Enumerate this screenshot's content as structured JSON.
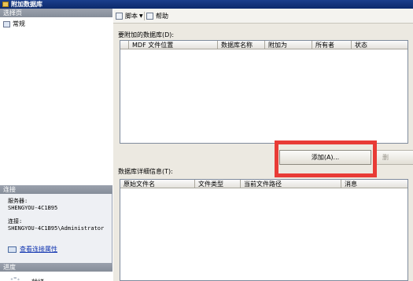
{
  "window": {
    "title": "附加数据库"
  },
  "left_panel": {
    "select_page_header": "选择页",
    "pages": [
      {
        "label": "常规"
      }
    ],
    "connection_header": "连接",
    "server_label": "服务器:",
    "server_value": "SHENGYOU-4C1B95",
    "connection_label": "连接:",
    "connection_value": "SHENGYOU-4C1B95\\Administrator",
    "view_connection_link": "查看连接属性",
    "progress_header": "进度",
    "status": "就绪"
  },
  "toolbar": {
    "script_label": "脚本",
    "help_label": "帮助"
  },
  "attach_grid": {
    "caption": "要附加的数据库(D):",
    "columns": [
      "MDF 文件位置",
      "数据库名称",
      "附加为",
      "所有者",
      "状态"
    ]
  },
  "buttons": {
    "add_label": "添加(A)...",
    "remove_label": "删"
  },
  "details_grid": {
    "caption": "数据库详细信息(T):",
    "columns": [
      "原始文件名",
      "文件类型",
      "当前文件路径",
      "消息"
    ]
  },
  "colors": {
    "highlight": "#e83b36"
  }
}
